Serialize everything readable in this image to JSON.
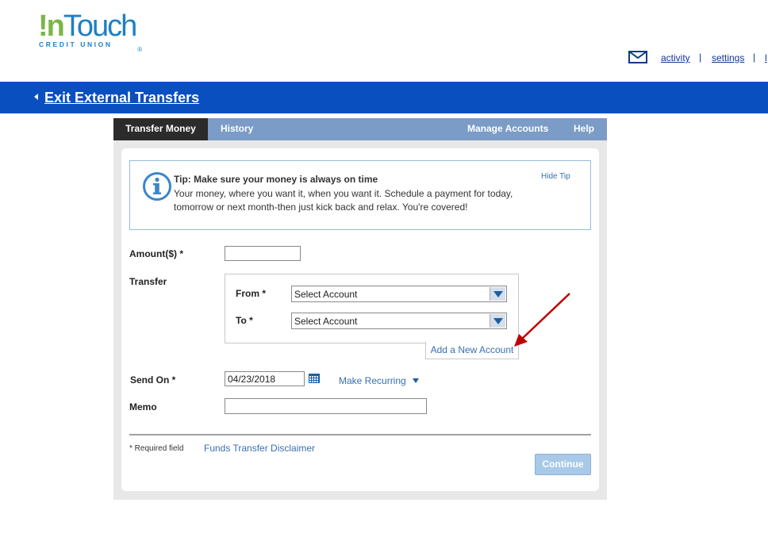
{
  "brand": {
    "logo_excl": "!",
    "logo_n": "n",
    "logo_touch": "Touch",
    "logo_reg": "®",
    "logo_sub": "CREDIT UNION"
  },
  "header": {
    "links": [
      "activity",
      "settings",
      "l"
    ],
    "separator": "|"
  },
  "nav": {
    "exit_label": "Exit External Transfers"
  },
  "tabs": {
    "left": [
      {
        "label": "Transfer Money",
        "active": true
      },
      {
        "label": "History",
        "active": false
      }
    ],
    "right": [
      {
        "label": "Manage Accounts"
      },
      {
        "label": "Help"
      }
    ]
  },
  "tip": {
    "title": "Tip: Make sure your money is always on time",
    "text": "Your money, where you want it, when you want it. Schedule a payment for today, tomorrow or next month-then just kick back and relax. You're covered!",
    "hide_label": "Hide Tip"
  },
  "form": {
    "amount_label": "Amount($) *",
    "amount_value": "",
    "transfer_label": "Transfer",
    "from_label": "From *",
    "from_value": "Select Account",
    "to_label": "To *",
    "to_value": "Select Account",
    "add_account_label": "Add a New Account",
    "send_on_label": "Send On *",
    "send_on_value": "04/23/2018",
    "make_recurring_label": "Make Recurring",
    "memo_label": "Memo",
    "memo_value": ""
  },
  "footer": {
    "required_note": "* Required field",
    "disclaimer_label": "Funds Transfer Disclaimer",
    "continue_label": "Continue"
  },
  "colors": {
    "nav_bar": "#0a4fc0",
    "tab_bar": "#7a9cc6",
    "active_tab": "#2b2b2b",
    "link": "#3a6fb0",
    "annotation_arrow": "#c00000"
  }
}
